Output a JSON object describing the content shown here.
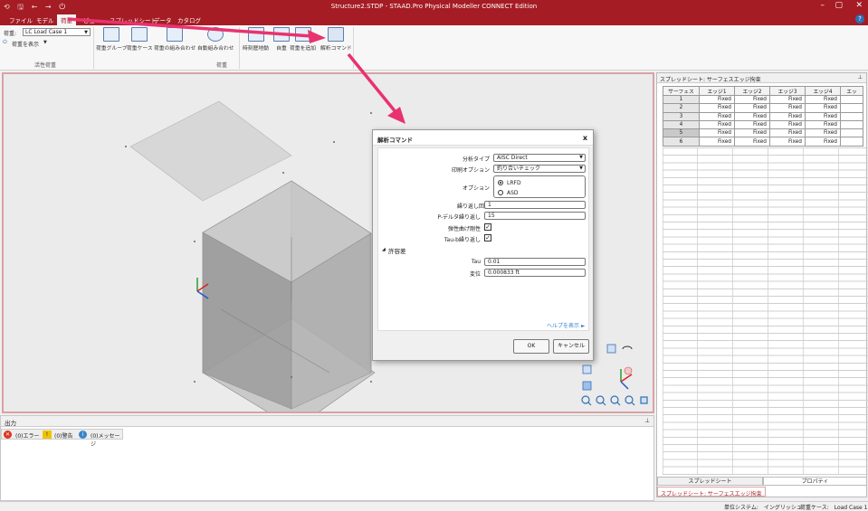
{
  "titlebar": {
    "title": "Structure2.STDP - STAAD.Pro Physical Modeller CONNECT Edition",
    "qa_icons": "⟲ 🖫 ← → ⏻",
    "minimize": "–",
    "maximize": "▢",
    "close": "✕"
  },
  "menu": {
    "file": "ファイル",
    "model": "モデル",
    "load": "荷重",
    "view": "ビュー",
    "spreadsheet": "スプレッドシート",
    "data": "データ",
    "catalog": "カタログ",
    "help": "?"
  },
  "ribbon": {
    "load_label": "荷重:",
    "load_case": "LC Load Case 1",
    "show_load": "荷重を表示",
    "group_active_load": "活性荷重",
    "group_load": "荷重",
    "buttons": {
      "load_group": "荷重グループ",
      "load_case": "荷重ケース",
      "load_combo": "荷重の組み合わせ",
      "auto_combo": "自動組み合わせ",
      "time_history": "時刻歴地動",
      "self_weight": "自重",
      "add_load": "荷重を追加",
      "analysis_command": "解析コマンド"
    }
  },
  "dialog": {
    "title": "解析コマンド",
    "close": "x",
    "analysis_type_label": "分析タイプ",
    "analysis_type_value": "AISC Direct",
    "print_option_label": "印刷オプション",
    "print_option_value": "釣り合いチェック",
    "option_label": "オプション",
    "opt_lrfd": "LRFD",
    "opt_asd": "ASD",
    "iter_count_label": "繰り返し回数",
    "iter_count_value": "1",
    "pdelta_label": "P-デルタ繰り返し",
    "pdelta_value": "15",
    "flex_stiff_label": "弾性曲げ剛性",
    "taub_label": "Tau-b繰り返し",
    "tolerance_section": "許容差",
    "tau_label": "Tau",
    "tau_value": "0.01",
    "disp_label": "変位",
    "disp_value": "0.000833 ft",
    "help_link": "ヘルプを表示 ►",
    "ok": "OK",
    "cancel": "キャンセル"
  },
  "output": {
    "title": "出力",
    "errors": "(0)エラー",
    "warnings": "(0)警告",
    "messages": "(0)メッセージ"
  },
  "sheet": {
    "title": "スプレッドシート: サーフェスエッジ拘束",
    "columns": [
      "サーフェス",
      "エッジ1",
      "エッジ2",
      "エッジ3",
      "エッジ4",
      "エッ"
    ],
    "rows": [
      {
        "id": "1",
        "vals": [
          "Fixed",
          "Fixed",
          "Fixed",
          "Fixed"
        ]
      },
      {
        "id": "2",
        "vals": [
          "Fixed",
          "Fixed",
          "Fixed",
          "Fixed"
        ]
      },
      {
        "id": "3",
        "vals": [
          "Fixed",
          "Fixed",
          "Fixed",
          "Fixed"
        ]
      },
      {
        "id": "4",
        "vals": [
          "Fixed",
          "Fixed",
          "Fixed",
          "Fixed"
        ]
      },
      {
        "id": "5",
        "vals": [
          "Fixed",
          "Fixed",
          "Fixed",
          "Fixed"
        ]
      },
      {
        "id": "6",
        "vals": [
          "Fixed",
          "Fixed",
          "Fixed",
          "Fixed"
        ]
      }
    ],
    "tab_spreadsheet": "スプレッドシート",
    "tab_properties": "プロパティ",
    "bottom_tab": "スプレッドシート: サーフェスエッジ拘束"
  },
  "status": {
    "unit": "単位システム:　イングリッシュ",
    "loadcase": "荷重ケース:　Load Case 1"
  },
  "colors": {
    "brand": "#a51c24",
    "arrow": "#e8336e"
  }
}
